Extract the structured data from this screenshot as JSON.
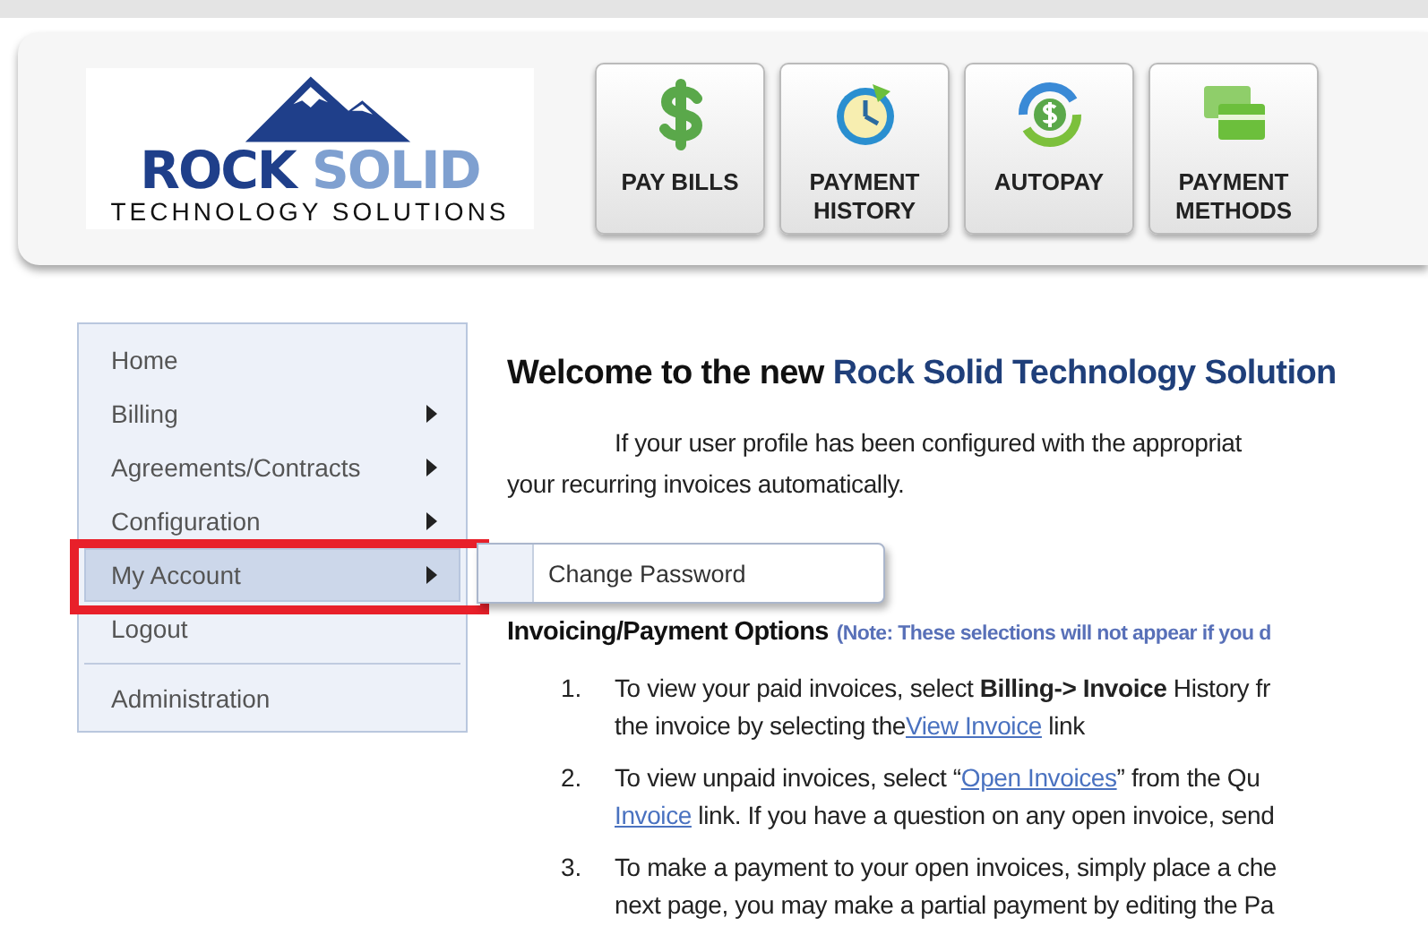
{
  "logo": {
    "brand_first": "ROCK",
    "brand_second": "SOLID",
    "tagline": "TECHNOLOGY SOLUTIONS"
  },
  "toolbar": [
    {
      "kind": "dollar",
      "lines": [
        "PAY BILLS"
      ]
    },
    {
      "kind": "clock",
      "lines": [
        "PAYMENT",
        "HISTORY"
      ]
    },
    {
      "kind": "cycle",
      "lines": [
        "AUTOPAY"
      ]
    },
    {
      "kind": "cards",
      "lines": [
        "PAYMENT",
        "METHODS"
      ]
    }
  ],
  "menu": {
    "items": [
      {
        "label": "Home",
        "has_submenu": false,
        "selected": false,
        "highlighted": false
      },
      {
        "label": "Billing",
        "has_submenu": true,
        "selected": false,
        "highlighted": false
      },
      {
        "label": "Agreements/Contracts",
        "has_submenu": true,
        "selected": false,
        "highlighted": false
      },
      {
        "label": "Configuration",
        "has_submenu": true,
        "selected": false,
        "highlighted": false
      },
      {
        "label": "My Account",
        "has_submenu": true,
        "selected": true,
        "highlighted": true
      },
      {
        "label": "Logout",
        "has_submenu": false,
        "selected": false,
        "highlighted": false
      }
    ],
    "lower_items": [
      {
        "label": "Administration",
        "has_submenu": false,
        "selected": false,
        "highlighted": false
      }
    ],
    "submenu": [
      "Change Password"
    ]
  },
  "content": {
    "title_start": "Welcome to the new ",
    "title_brand": "Rock Solid Technology Solution",
    "intro": [
      "If your user profile has been configured with the appropriat",
      "your recurring invoices automatically."
    ],
    "section_title": "Invoicing/Payment Options",
    "section_note": "(Note: These selections will not appear if you d",
    "steps": [
      {
        "number": "1.",
        "lines": [
          [
            {
              "text": "To view your paid invoices, select **Billing-> Invoice** History fr"
            }
          ],
          [
            {
              "text": "the invoice by selecting the"
            },
            {
              "link": "View Invoice"
            },
            {
              "text": " link"
            }
          ]
        ]
      },
      {
        "number": "2.",
        "lines": [
          [
            {
              "text": "To view unpaid invoices, select “"
            },
            {
              "link": "Open Invoices"
            },
            {
              "text": "” from the Qu"
            }
          ],
          [
            {
              "link": "Invoice"
            },
            {
              "text": " link. If you have a question on any open invoice, send"
            }
          ]
        ]
      },
      {
        "number": "3.",
        "lines": [
          [
            {
              "text": "To make a payment to your open invoices, simply place a che"
            }
          ],
          [
            {
              "text": "next page, you may make a partial payment by editing the Pa"
            }
          ]
        ]
      }
    ]
  }
}
